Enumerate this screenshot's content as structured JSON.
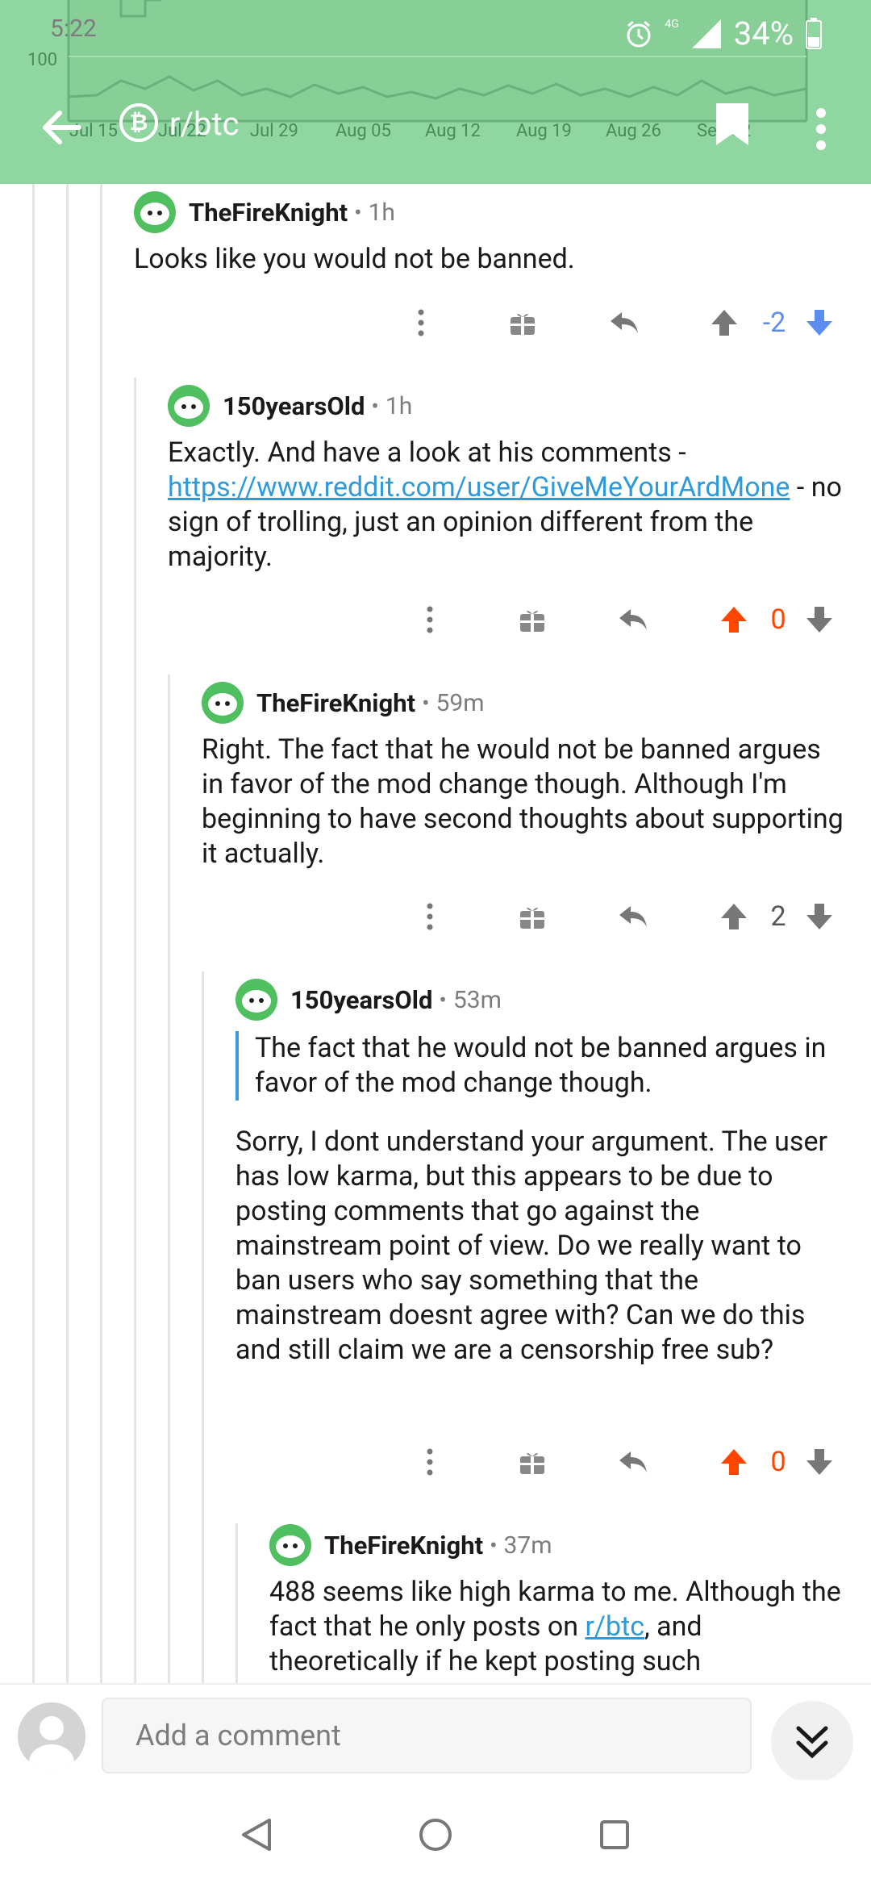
{
  "status_bar": {
    "time": "5:22",
    "network": "4G",
    "battery": "34%"
  },
  "header": {
    "subreddit": "r/btc",
    "chart_axis": {
      "y_label": "100",
      "x_labels": [
        "Jul 15",
        "Jul 22",
        "Jul 29",
        "Aug 05",
        "Aug 12",
        "Aug 19",
        "Aug 26",
        "Sep 02"
      ]
    }
  },
  "comments": [
    {
      "author": "TheFireKnight",
      "time": "1h",
      "text": "Looks like you would not be banned.",
      "score": "-2",
      "vote": "down"
    },
    {
      "author": "150yearsOld",
      "time": "1h",
      "text_pre": "Exactly. And have a look at his comments - ",
      "link": "https://www.reddit.com/user/GiveMeYourArdMone",
      "text_post": " - no sign of trolling, just an opinion different from the majority.",
      "score": "0",
      "vote": "up"
    },
    {
      "author": "TheFireKnight",
      "time": "59m",
      "text": "Right. The fact that he would not be banned argues in favor of the mod change though. Although I'm beginning to have second thoughts about supporting it actually.",
      "score": "2",
      "vote": "none"
    },
    {
      "author": "150yearsOld",
      "time": "53m",
      "quote": "The fact that he would not be banned argues in favor of the mod change though.",
      "text": "Sorry, I dont understand your argument. The user has low karma, but this appears to be due to posting comments that go against the mainstream point of view. Do we really want to ban users who say something that the mainstream doesnt agree with? Can we do this and still claim we are a censorship free sub?",
      "score": "0",
      "vote": "up"
    },
    {
      "author": "TheFireKnight",
      "time": "37m",
      "text_pre": "488 seems like high karma to me. Although the fact that he only posts on ",
      "link": "r/btc",
      "text_post": ", and theoretically if he kept posting such"
    }
  ],
  "bottom": {
    "placeholder": "Add a comment"
  },
  "colors": {
    "header_bg": "#8fd6a0",
    "upvote": "#ff4500",
    "downvote": "#5d8cf0",
    "link": "#2d9adb"
  }
}
